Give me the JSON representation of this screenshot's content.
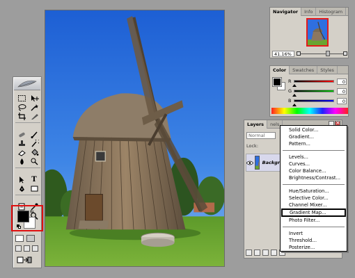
{
  "navigator_panel": {
    "tabs": [
      "Navigator",
      "Info",
      "Histogram"
    ],
    "zoom_value": "41.16%"
  },
  "color_panel": {
    "tabs": [
      "Color",
      "Swatches",
      "Styles"
    ],
    "sliders": [
      {
        "label": "R",
        "value": "0",
        "color": "#ff0000"
      },
      {
        "label": "G",
        "value": "0",
        "color": "#00c000"
      },
      {
        "label": "B",
        "value": "0",
        "color": "#0000ff"
      }
    ]
  },
  "layers_panel": {
    "tabs": [
      "Layers",
      "nels",
      ""
    ],
    "blend_mode": "Normal",
    "lock_label": "Lock:",
    "layer_name": "Backgr"
  },
  "adjustment_menu": {
    "group1": [
      "Solid Color...",
      "Gradient...",
      "Pattern..."
    ],
    "group2": [
      "Levels...",
      "Curves...",
      "Color Balance...",
      "Brightness/Contrast..."
    ],
    "group3": [
      "Hue/Saturation...",
      "Selective Color...",
      "Channel Mixer...",
      "Gradient Map...",
      "Photo Filter..."
    ],
    "group4": [
      "Invert",
      "Threshold...",
      "Posterize..."
    ],
    "highlighted": "Gradient Map..."
  },
  "toolbox": {
    "foreground_color": "#000000",
    "background_color": "#ffffff",
    "type_tool_glyph": "T",
    "highlight_color": "#e01010"
  }
}
